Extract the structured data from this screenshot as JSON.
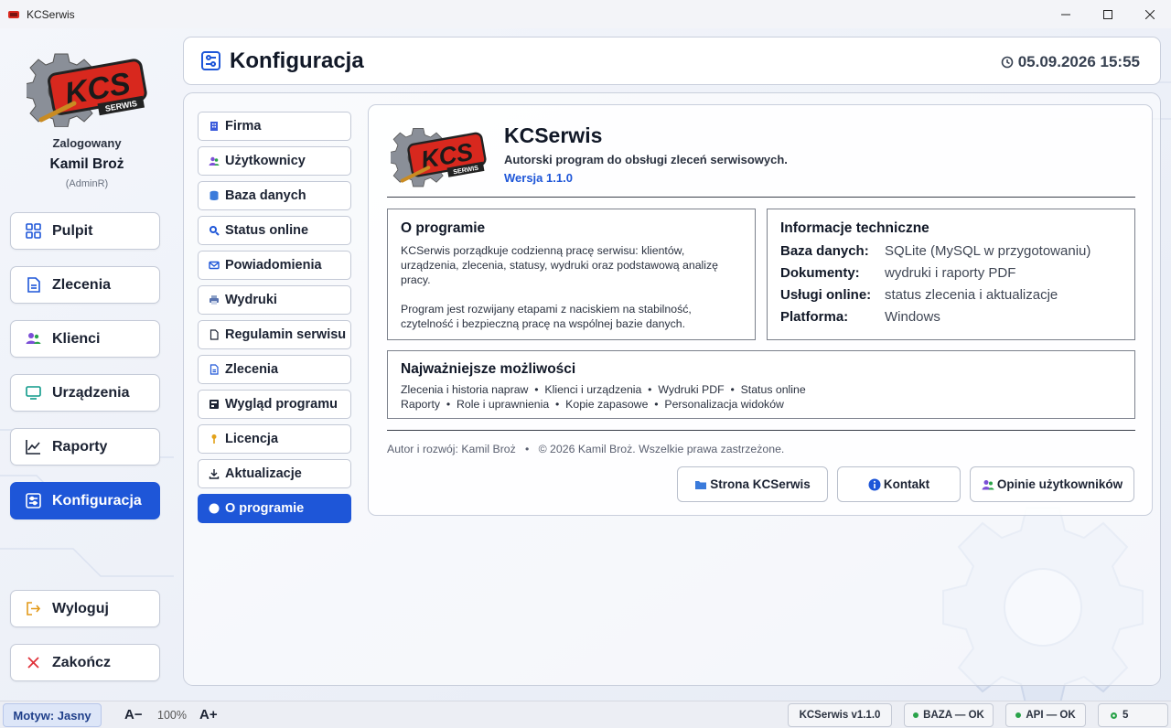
{
  "window": {
    "title": "KCSerwis"
  },
  "sidebar": {
    "logo_text": "KCS",
    "logo_sub": "SERWIS",
    "logged_label": "Zalogowany",
    "user_name": "Kamil Broż",
    "user_role": "(AdminR)",
    "nav": [
      {
        "label": "Pulpit",
        "icon": "grid-icon"
      },
      {
        "label": "Zlecenia",
        "icon": "document-icon"
      },
      {
        "label": "Klienci",
        "icon": "users-icon"
      },
      {
        "label": "Urządzenia",
        "icon": "monitor-icon"
      },
      {
        "label": "Raporty",
        "icon": "chart-icon"
      },
      {
        "label": "Konfiguracja",
        "icon": "settings-panel-icon",
        "active": true
      }
    ],
    "logout_label": "Wyloguj",
    "exit_label": "Zakończ"
  },
  "header": {
    "title": "Konfiguracja",
    "datetime": "05.09.2026 15:55"
  },
  "subnav": [
    {
      "label": "Firma",
      "icon": "building-icon"
    },
    {
      "label": "Użytkownicy",
      "icon": "users-icon"
    },
    {
      "label": "Baza danych",
      "icon": "database-icon"
    },
    {
      "label": "Status online",
      "icon": "search-icon"
    },
    {
      "label": "Powiadomienia",
      "icon": "mail-icon"
    },
    {
      "label": "Wydruki",
      "icon": "printer-icon"
    },
    {
      "label": "Regulamin serwisu",
      "icon": "page-icon"
    },
    {
      "label": "Zlecenia",
      "icon": "document-icon"
    },
    {
      "label": "Wygląd programu",
      "icon": "palette-icon"
    },
    {
      "label": "Licencja",
      "icon": "key-icon"
    },
    {
      "label": "Aktualizacje",
      "icon": "download-icon"
    },
    {
      "label": "O programie",
      "icon": "circle-icon",
      "active": true
    }
  ],
  "about": {
    "app_name": "KCSerwis",
    "subtitle": "Autorski program do obsługi zleceń serwisowych.",
    "version": "Wersja 1.1.0",
    "program": {
      "title": "O programie",
      "p1": "KCSerwis porządkuje codzienną pracę serwisu: klientów, urządzenia, zlecenia, statusy, wydruki oraz podstawową analizę pracy.",
      "p2": "Program jest rozwijany etapami z naciskiem na stabilność, czytelność i bezpieczną pracę na wspólnej bazie danych."
    },
    "tech": {
      "title": "Informacje techniczne",
      "rows": [
        {
          "k": "Baza danych:",
          "v": "SQLite (MySQL w przygotowaniu)"
        },
        {
          "k": "Dokumenty:",
          "v": "wydruki i raporty PDF"
        },
        {
          "k": "Usługi online:",
          "v": "status zlecenia i aktualizacje"
        },
        {
          "k": "Platforma:",
          "v": "Windows"
        }
      ]
    },
    "features": {
      "title": "Najważniejsze możliwości",
      "line1": "Zlecenia i historia napraw  •  Klienci i urządzenia  •  Wydruki PDF  •  Status online",
      "line2": "Raporty  •  Role i uprawnienia  •  Kopie zapasowe  •  Personalizacja widoków"
    },
    "author_line": "Autor i rozwój: Kamil Broż   •   © 2026 Kamil Broż. Wszelkie prawa zastrzeżone.",
    "buttons": {
      "site": "Strona KCSerwis",
      "contact": "Kontakt",
      "reviews": "Opinie użytkowników"
    }
  },
  "statusbar": {
    "theme": "Motyw: Jasny",
    "zoom_out": "A−",
    "zoom_level": "100%",
    "zoom_in": "A+",
    "version": "KCSerwis v1.1.0",
    "db": "BAZA — OK",
    "api": "API — OK",
    "notif_count": "5"
  },
  "colors": {
    "accent": "#1e56d8",
    "logo_red": "#d8281e",
    "ok_green": "#2aa34a"
  }
}
